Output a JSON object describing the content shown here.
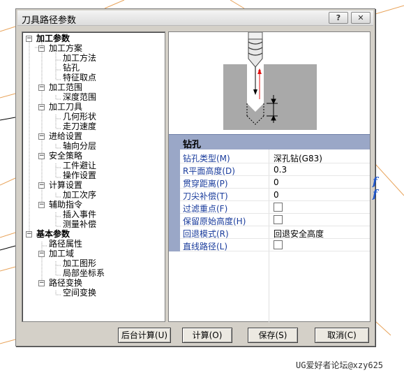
{
  "window": {
    "title": "刀具路径参数",
    "help_label": "?",
    "close_label": "✕"
  },
  "tree": [
    {
      "label": "加工参数",
      "bold": true,
      "expander": "−"
    },
    {
      "label": "加工方案",
      "expander": "−"
    },
    {
      "label": "加工方法"
    },
    {
      "label": "钻孔"
    },
    {
      "label": "特征取点"
    },
    {
      "label": "加工范围",
      "expander": "−"
    },
    {
      "label": "深度范围"
    },
    {
      "label": "加工刀具",
      "expander": "−"
    },
    {
      "label": "几何形状"
    },
    {
      "label": "走刀速度"
    },
    {
      "label": "进给设置",
      "expander": "−"
    },
    {
      "label": "轴向分层"
    },
    {
      "label": "安全策略",
      "expander": "−"
    },
    {
      "label": "工件避让"
    },
    {
      "label": "操作设置"
    },
    {
      "label": "计算设置",
      "expander": "−"
    },
    {
      "label": "加工次序"
    },
    {
      "label": "辅助指令",
      "expander": "−"
    },
    {
      "label": "插入事件"
    },
    {
      "label": "测量补偿"
    },
    {
      "label": "基本参数",
      "bold": true,
      "expander": "−"
    },
    {
      "label": "路径属性"
    },
    {
      "label": "加工域",
      "expander": "−"
    },
    {
      "label": "加工图形"
    },
    {
      "label": "局部坐标系"
    },
    {
      "label": "路径变换",
      "expander": "−"
    },
    {
      "label": "空间变换"
    }
  ],
  "section": {
    "title": "钻孔"
  },
  "properties": [
    {
      "label": "钻孔类型(M)",
      "value": "深孔钻(G83)",
      "type": "dropdown"
    },
    {
      "label": "R平面高度(D)",
      "value": "0.3",
      "type": "text"
    },
    {
      "label": "贯穿距离(P)",
      "value": "0",
      "type": "text",
      "fx": "f"
    },
    {
      "label": "刀尖补偿(T)",
      "value": "0",
      "type": "text",
      "fx": "f"
    },
    {
      "label": "过滤重点(F)",
      "value": "",
      "type": "checkbox",
      "checked": false
    },
    {
      "label": "保留原始高度(H)",
      "value": "",
      "type": "checkbox",
      "checked": false
    },
    {
      "label": "回退模式(R)",
      "value": "回退安全高度",
      "type": "dropdown"
    },
    {
      "label": "直线路径(L)",
      "value": "",
      "type": "checkbox",
      "checked": false
    }
  ],
  "buttons": {
    "background_calc": "后台计算(U)",
    "calc": "计算(O)",
    "save": "保存(S)",
    "cancel": "取消(C)"
  },
  "watermark": "UG爱好者论坛@xzy625",
  "colors": {
    "section_band": "#9aa7c7",
    "label_blue": "#1a3c9c",
    "dialog_bg": "#d4d0c8",
    "drill_arrow": "#e01010"
  }
}
